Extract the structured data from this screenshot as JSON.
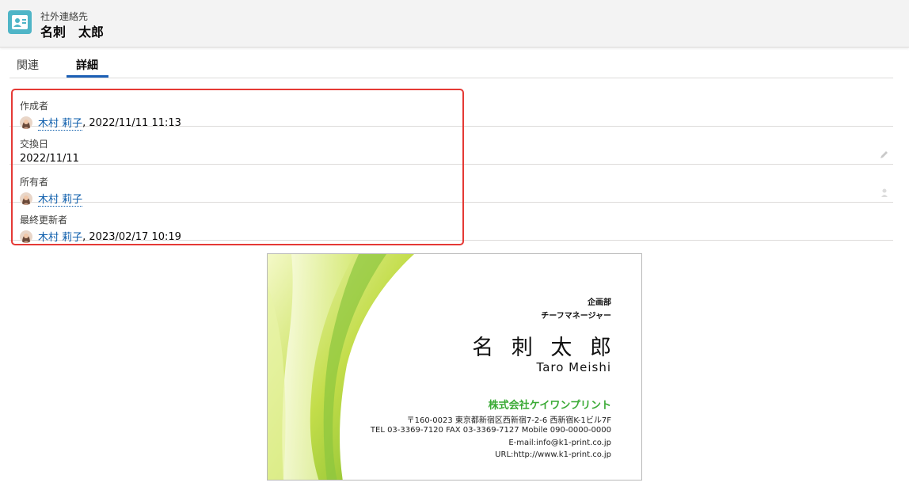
{
  "header": {
    "object_type": "社外連絡先",
    "record_name": "名刺　太郎",
    "icon": "contact-card-icon"
  },
  "tabs": [
    {
      "label": "関連",
      "active": false
    },
    {
      "label": "詳細",
      "active": true
    }
  ],
  "fields": {
    "created_by": {
      "label": "作成者",
      "user": "木村 莉子",
      "suffix": ", 2022/11/11 11:13"
    },
    "exchange_date": {
      "label": "交換日",
      "value": "2022/11/11"
    },
    "owner": {
      "label": "所有者",
      "user": "木村 莉子"
    },
    "last_modified_by": {
      "label": "最終更新者",
      "user": "木村 莉子",
      "suffix": ", 2023/02/17 10:19"
    }
  },
  "business_card": {
    "department": "企画部",
    "title": "チーフマネージャー",
    "name": "名 刺 太 郎",
    "name_roman": "Taro Meishi",
    "company": "株式会社ケイワンプリント",
    "address": "〒160-0023 東京都新宿区西新宿7-2-6 西新宿K-1ビル7F",
    "phones": "TEL 03-3369-7120  FAX 03-3369-7127  Mobile 090-0000-0000",
    "email": "E-mail:info@k1-print.co.jp",
    "url": "URL:http://www.k1-print.co.jp"
  },
  "colors": {
    "link": "#0b5cab",
    "tab_underline": "#1b5fb5",
    "highlight_border": "#e53935",
    "company_green": "#3aaa35",
    "icon_teal": "#4fb5c7"
  }
}
